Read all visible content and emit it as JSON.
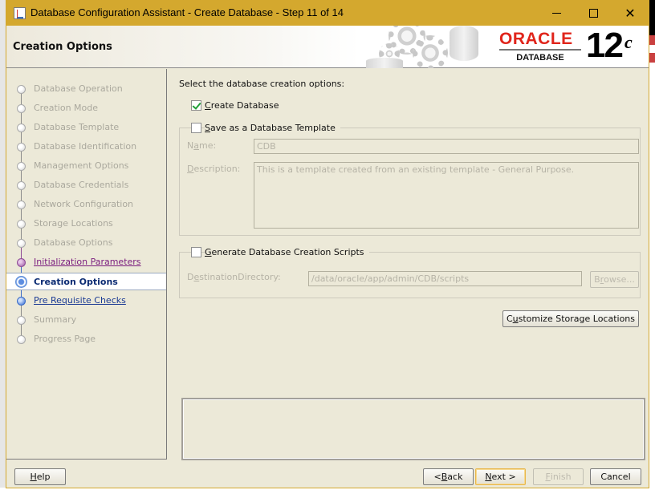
{
  "window": {
    "title": "Database Configuration Assistant - Create Database - Step 11 of 14",
    "controls": [
      "minimize",
      "maximize",
      "close"
    ]
  },
  "header": {
    "page_title": "Creation Options",
    "brand": {
      "wordmark": "ORACLE",
      "product": "DATABASE",
      "version": "12",
      "version_suffix": "c",
      "accent_color": "#e0251b"
    }
  },
  "nav": {
    "steps": [
      {
        "label": "Database Operation",
        "state": "pending"
      },
      {
        "label": "Creation Mode",
        "state": "pending"
      },
      {
        "label": "Database Template",
        "state": "pending"
      },
      {
        "label": "Database Identification",
        "state": "pending"
      },
      {
        "label": "Management Options",
        "state": "pending"
      },
      {
        "label": "Database Credentials",
        "state": "pending"
      },
      {
        "label": "Network Configuration",
        "state": "pending"
      },
      {
        "label": "Storage Locations",
        "state": "pending"
      },
      {
        "label": "Database Options",
        "state": "pending"
      },
      {
        "label": "Initialization Parameters",
        "state": "visited"
      },
      {
        "label": "Creation Options",
        "state": "current"
      },
      {
        "label": "Pre Requisite Checks",
        "state": "next"
      },
      {
        "label": "Summary",
        "state": "pending"
      },
      {
        "label": "Progress Page",
        "state": "pending"
      }
    ]
  },
  "main": {
    "intro": "Select the database creation options:",
    "create_database": {
      "mnemonic": "C",
      "rest": "reate Database",
      "checked": true
    },
    "save_template": {
      "mnemonic": "S",
      "rest": "ave as a Database Template",
      "checked": false,
      "name_label_pre": "N",
      "name_label_mn": "a",
      "name_label_post": "me:",
      "name_value": "CDB",
      "desc_label_mn": "D",
      "desc_label_post": "escription:",
      "desc_value": "This is a template created from an existing template - General Purpose."
    },
    "generate_scripts": {
      "mnemonic": "G",
      "rest": "enerate Database Creation Scripts",
      "checked": false,
      "dest_label_pre": "D",
      "dest_label_mn": "e",
      "dest_label_post": "stinationDirectory:",
      "dest_value": "/data/oracle/app/admin/CDB/scripts",
      "browse_pre": "B",
      "browse_mn": "r",
      "browse_post": "owse..."
    },
    "customize_button": {
      "pre": "C",
      "mn": "u",
      "post": "stomize Storage Locations"
    },
    "message_area": ""
  },
  "footer": {
    "help": {
      "mn": "H",
      "post": "elp"
    },
    "back": {
      "pre": "< ",
      "mn": "B",
      "post": "ack"
    },
    "next": {
      "mn": "N",
      "post": "ext >"
    },
    "finish": {
      "mn": "F",
      "post": "inish",
      "enabled": false
    },
    "cancel": {
      "label": "Cancel"
    }
  }
}
